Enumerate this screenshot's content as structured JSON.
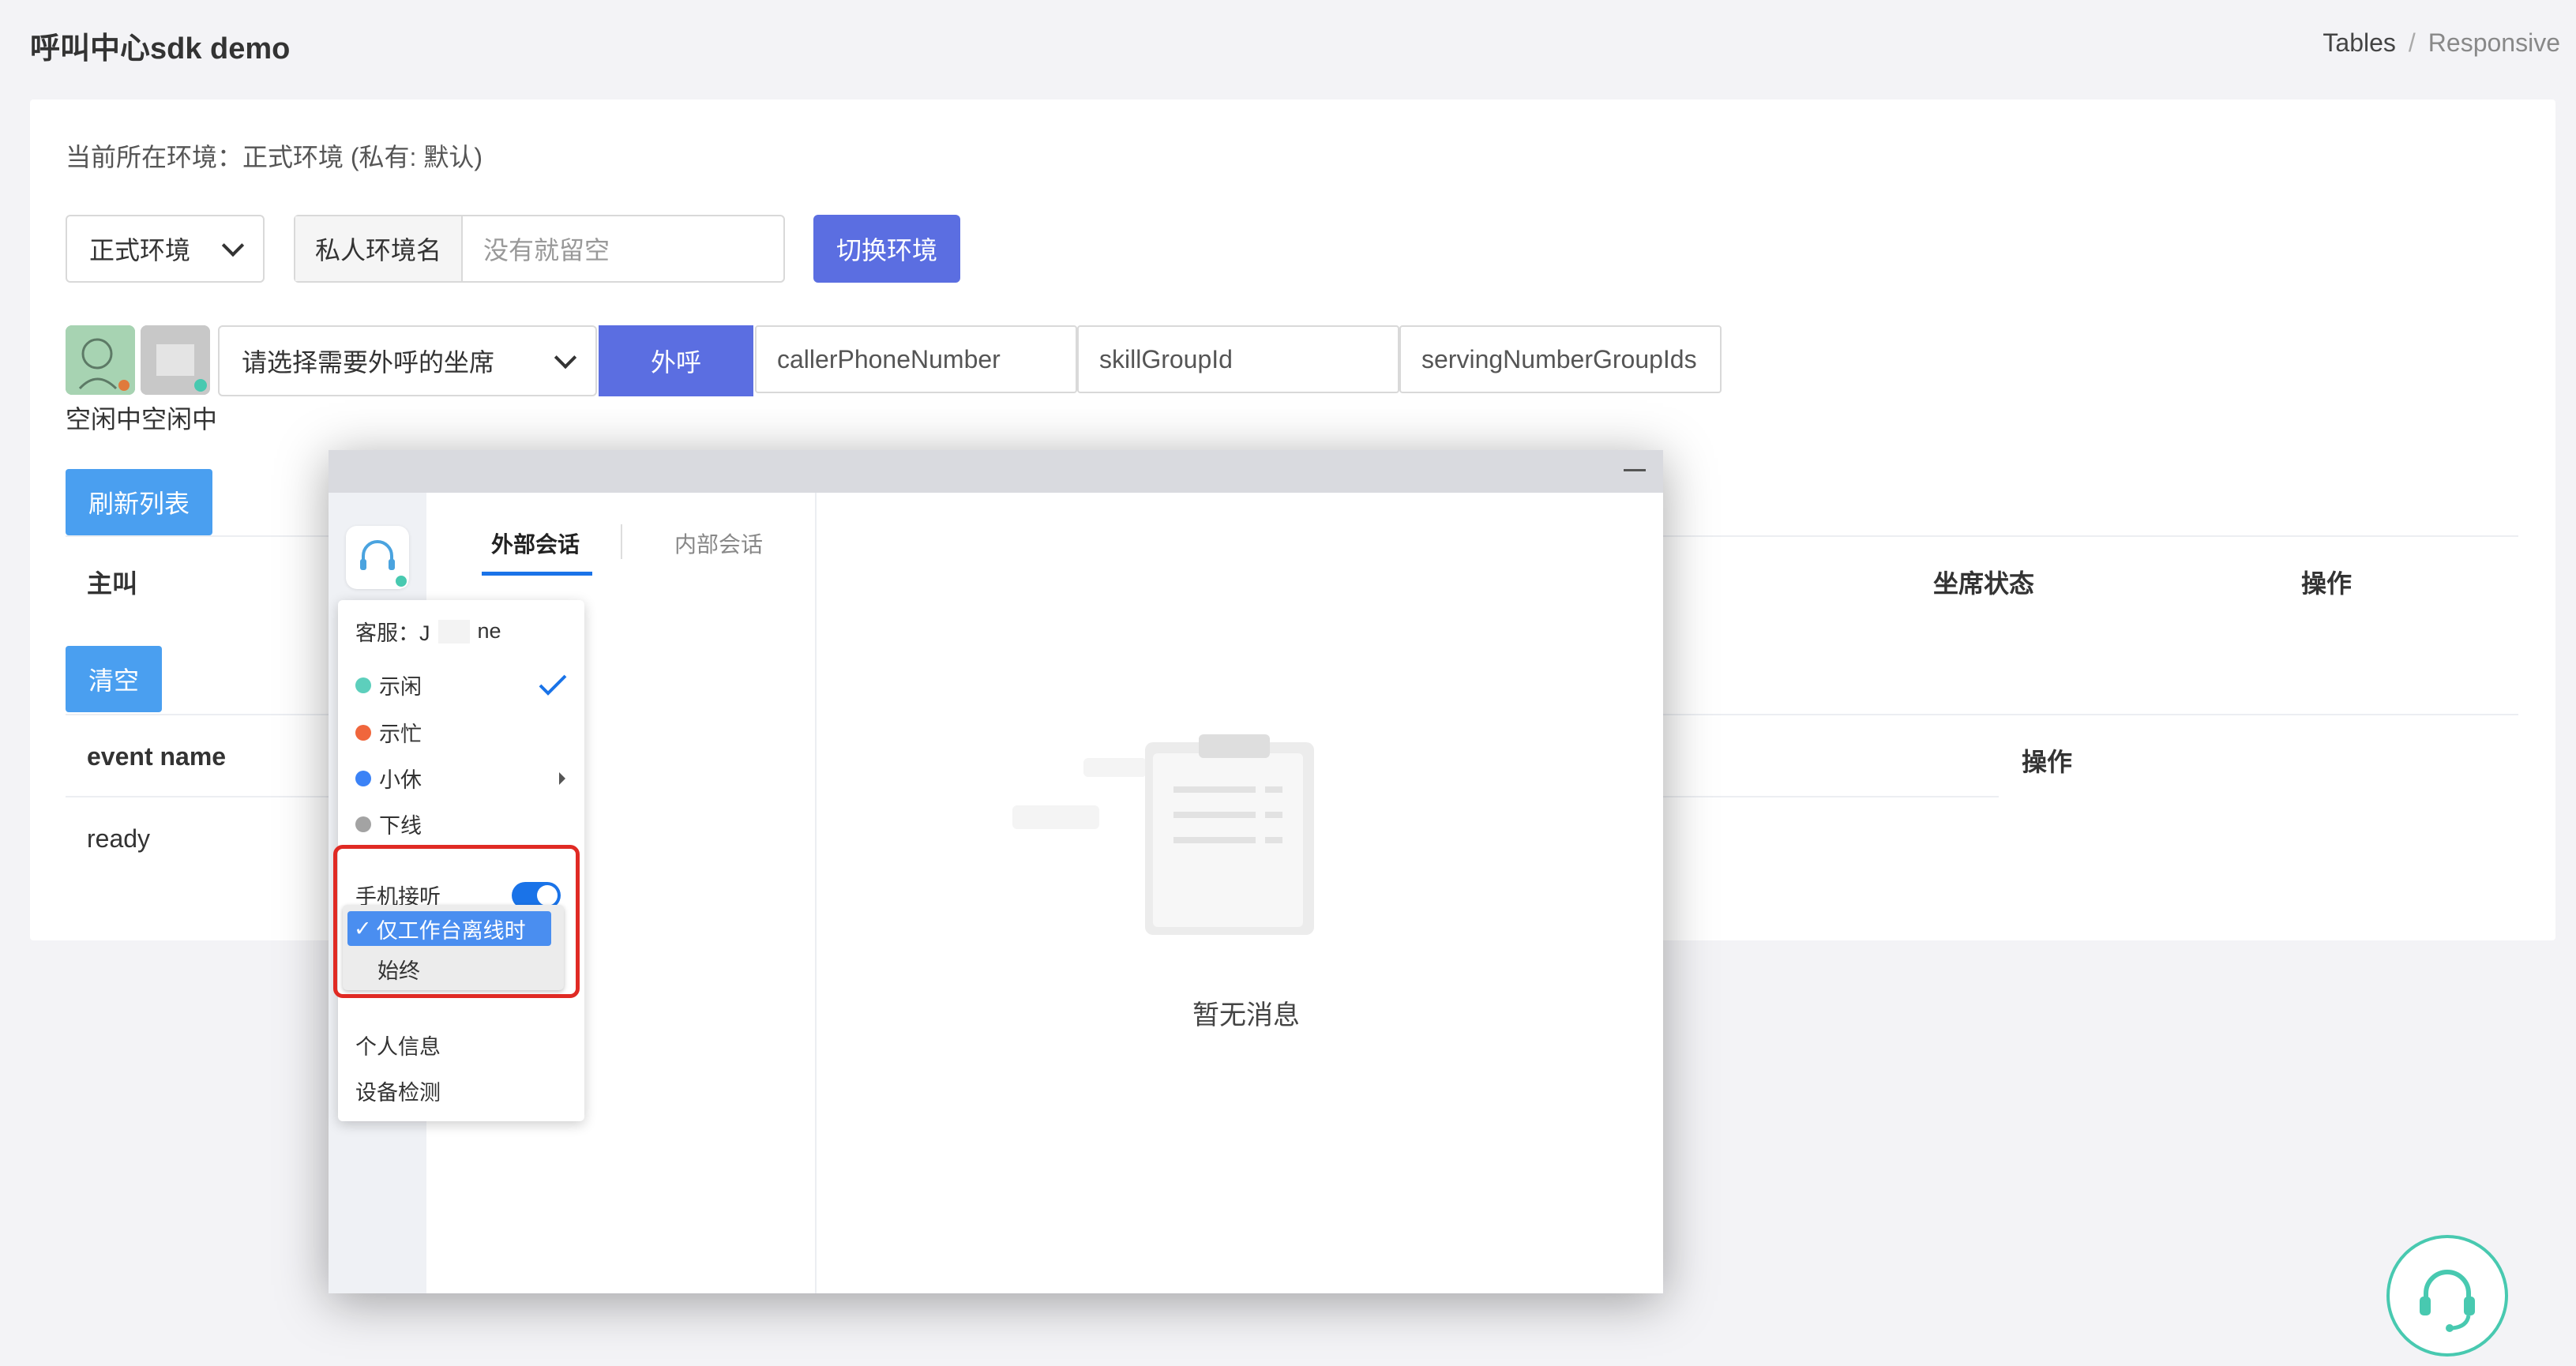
{
  "header": {
    "title": "呼叫中心sdk demo",
    "breadcrumb": [
      "Tables",
      "Responsive"
    ],
    "breadcrumb_sep": "/"
  },
  "env": {
    "current_text": "当前所在环境：正式环境 (私有: 默认)",
    "select_value": "正式环境",
    "private_label": "私人环境名",
    "private_placeholder": "没有就留空",
    "switch_button": "切换环境"
  },
  "call": {
    "agent_placeholder": "请选择需要外呼的坐席",
    "call_button": "外呼",
    "caller_field": "callerPhoneNumber",
    "skill_field": "skillGroupId",
    "serving_field": "servingNumberGroupIds",
    "status_text": "空闲中空闲中"
  },
  "table1": {
    "refresh_button": "刷新列表",
    "headers": [
      "主叫",
      "坐席状态",
      "操作"
    ]
  },
  "table2": {
    "clear_button": "清空",
    "headers": [
      "event name",
      "操作"
    ],
    "rows": [
      "ready"
    ]
  },
  "popup": {
    "tabs": [
      "外部会话",
      "内部会话"
    ],
    "empty_text": "暂无消息",
    "menu": {
      "agent_label": "客服：J",
      "agent_suffix": "ne",
      "statuses": [
        {
          "label": "示闲",
          "color": "#5dcfbc"
        },
        {
          "label": "示忙",
          "color": "#f0663c"
        },
        {
          "label": "小休",
          "color": "#3b82f6"
        },
        {
          "label": "下线",
          "color": "#a3a3a3"
        }
      ],
      "phone_answer": "手机接听",
      "dropdown_options": [
        "仅工作台离线时",
        "始终"
      ],
      "personal_info": "个人信息",
      "device_check": "设备检测"
    }
  },
  "colors": {
    "primary": "#5b6ee1",
    "accent_blue": "#4a9ff0",
    "highlight_red": "#e02a24",
    "teal": "#48c9b0"
  }
}
